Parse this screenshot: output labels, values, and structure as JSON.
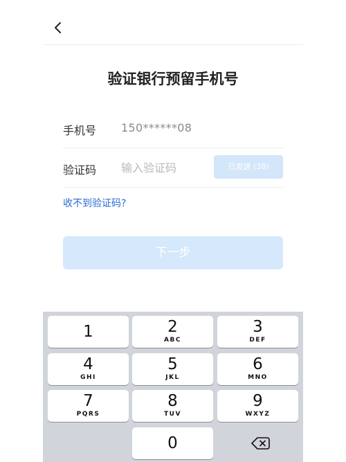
{
  "page": {
    "title": "验证银行预留手机号"
  },
  "form": {
    "phone_label": "手机号",
    "phone_value": "150******08",
    "code_label": "验证码",
    "code_placeholder": "输入验证码",
    "send_button": "已发送 (38)"
  },
  "help_link": "收不到验证码?",
  "next_button": "下一步",
  "keyboard": {
    "keys": [
      {
        "num": "1",
        "letters": ""
      },
      {
        "num": "2",
        "letters": "ABC"
      },
      {
        "num": "3",
        "letters": "DEF"
      },
      {
        "num": "4",
        "letters": "GHI"
      },
      {
        "num": "5",
        "letters": "JKL"
      },
      {
        "num": "6",
        "letters": "MNO"
      },
      {
        "num": "7",
        "letters": "PQRS"
      },
      {
        "num": "8",
        "letters": "TUV"
      },
      {
        "num": "9",
        "letters": "WXYZ"
      },
      {
        "num": "0",
        "letters": ""
      }
    ],
    "delete_icon": "backspace-icon"
  },
  "colors": {
    "accent_link": "#2b6cd6",
    "button_disabled": "#d6e8fb",
    "keyboard_bg": "#d1d4da"
  }
}
